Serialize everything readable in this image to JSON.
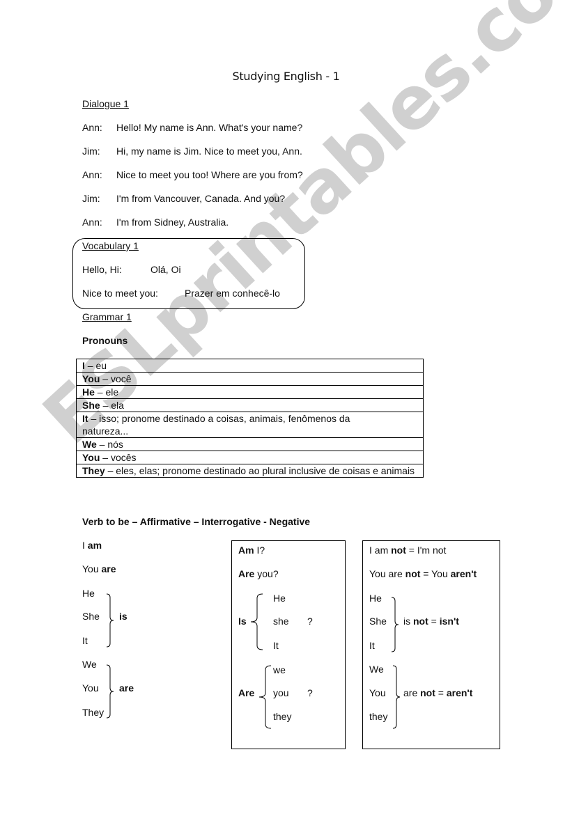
{
  "page": {
    "title": "Studying English - 1",
    "watermark": "ESLprintables.com"
  },
  "dialogue": {
    "heading": "Dialogue 1",
    "lines": [
      {
        "speaker": "Ann:",
        "text": "Hello! My name is Ann. What's your name?"
      },
      {
        "speaker": "Jim:",
        "text": "Hi, my name is Jim. Nice to meet you, Ann."
      },
      {
        "speaker": "Ann:",
        "text": "Nice to meet you too! Where are you from?"
      },
      {
        "speaker": "Jim:",
        "text": "I'm from Vancouver, Canada. And you?"
      },
      {
        "speaker": "Ann:",
        "text": "I'm from Sidney, Australia."
      }
    ]
  },
  "vocabulary": {
    "heading": "Vocabulary 1",
    "items": [
      {
        "term": "Hello, Hi:",
        "translation": "Olá, Oi"
      },
      {
        "term": "Nice to meet you:",
        "translation": "Prazer em conhecê-lo"
      }
    ]
  },
  "grammar": {
    "heading": "Grammar 1",
    "pronouns_heading": "Pronouns",
    "pronouns": [
      {
        "pronoun": "I",
        "meaning": " – eu"
      },
      {
        "pronoun": "You",
        "meaning": " – você"
      },
      {
        "pronoun": "He",
        "meaning": " – ele"
      },
      {
        "pronoun": "She",
        "meaning": " – ela"
      },
      {
        "pronoun": "It",
        "meaning": " – isso; pronome destinado a coisas, animais, fenômenos da natureza..."
      },
      {
        "pronoun": "We",
        "meaning": " – nós"
      },
      {
        "pronoun": "You",
        "meaning": " – vocês"
      },
      {
        "pronoun": "They",
        "meaning": " – eles, elas; pronome destinado ao plural inclusive de coisas e animais"
      }
    ]
  },
  "verb_to_be": {
    "heading": "Verb to be  – Affirmative – Interrogative - Negative",
    "affirmative": {
      "i_subject": "I ",
      "i_verb": "am",
      "you_subject": "You ",
      "you_verb": "are",
      "group1": [
        "He",
        "She",
        "It"
      ],
      "group1_verb": "is",
      "group2": [
        "We",
        "You",
        "They"
      ],
      "group2_verb": "are"
    },
    "interrogative": {
      "line1_verb": "Am",
      "line1_rest": " I?",
      "line2_verb": "Are",
      "line2_rest": " you?",
      "group1_verb": "Is",
      "group1": [
        "He",
        "she",
        "It"
      ],
      "group1_mark": "?",
      "group2_verb": "Are",
      "group2": [
        "we",
        "you",
        "they"
      ],
      "group2_mark": "?"
    },
    "negative": {
      "line1_a": "I am ",
      "line1_not": "not",
      "line1_b": " = I'm not",
      "line2_a": "You are ",
      "line2_not": "not",
      "line2_b": " = You ",
      "line2_contr": "aren't",
      "group1": [
        "He",
        "She",
        "It"
      ],
      "group1_a": "is ",
      "group1_not": "not",
      "group1_eq": " = ",
      "group1_contr": "isn't",
      "group2": [
        "We",
        "You",
        "they"
      ],
      "group2_a": "are ",
      "group2_not": "not",
      "group2_eq": " = ",
      "group2_contr": "aren't"
    }
  }
}
